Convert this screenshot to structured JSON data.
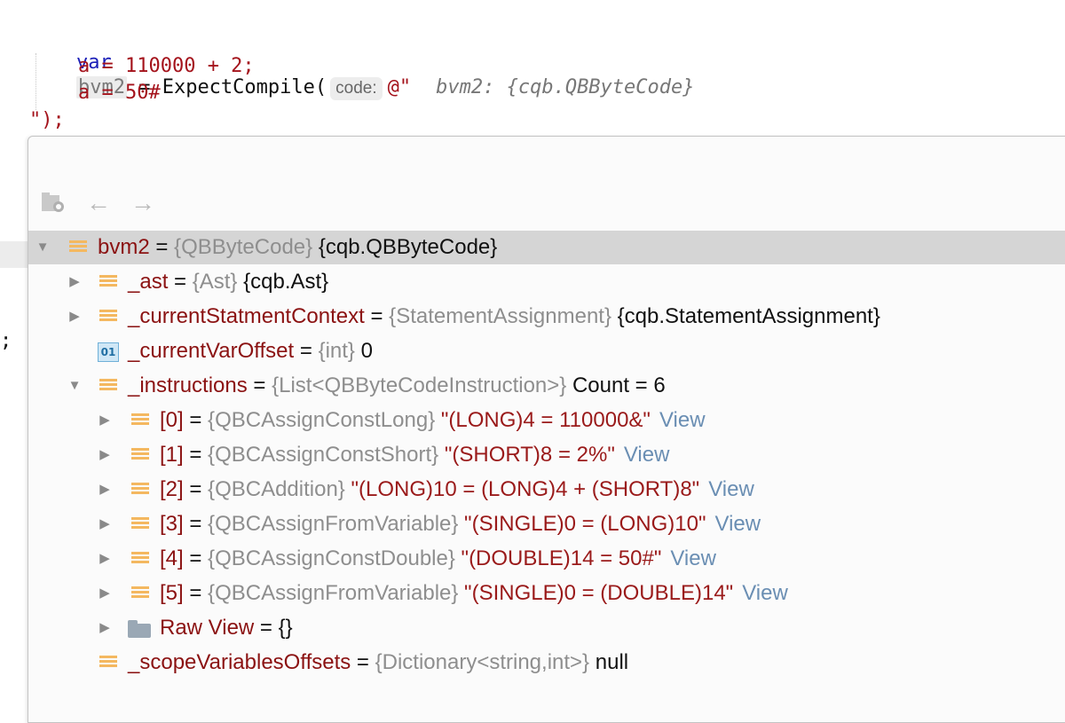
{
  "editor": {
    "line1": {
      "keyword": "var",
      "variable": "bvm2",
      "call": " = ExpectCompile(",
      "param_hint": "code:",
      "string_open": "@\"",
      "inline_value": "bvm2: {cqb.QBByteCode}"
    },
    "line2": "a = 110000 + 2;",
    "line3": "a = 50#",
    "line4": "\");",
    "left_fragment": ";"
  },
  "popup": {
    "toolbar": {
      "icons": [
        "watch-icon",
        "back-arrow-icon",
        "forward-arrow-icon"
      ]
    },
    "tree": [
      {
        "name": "bvm2",
        "eq": " = ",
        "type": "{QBByteCode}",
        "value": " {cqb.QBByteCode}"
      },
      {
        "name": "_ast",
        "eq": " = ",
        "type": "{Ast}",
        "value": " {cqb.Ast}"
      },
      {
        "name": "_currentStatmentContext",
        "eq": " = ",
        "type": "{StatementAssignment}",
        "value": " {cqb.StatementAssignment}"
      },
      {
        "name": "_currentVarOffset",
        "eq": " = ",
        "type": "{int}",
        "value": " 0",
        "icon_text": "01"
      },
      {
        "name": "_instructions",
        "eq": " = ",
        "type": "{List<QBByteCodeInstruction>}",
        "value": " Count = 6"
      },
      {
        "name": "[0]",
        "eq": " = ",
        "type": "{QBCAssignConstLong}",
        "value": " \"(LONG)4 = 110000&\"",
        "link": "View"
      },
      {
        "name": "[1]",
        "eq": " = ",
        "type": "{QBCAssignConstShort}",
        "value": " \"(SHORT)8 = 2%\"",
        "link": "View"
      },
      {
        "name": "[2]",
        "eq": " = ",
        "type": "{QBCAddition}",
        "value": " \"(LONG)10 = (LONG)4 + (SHORT)8\"",
        "link": "View"
      },
      {
        "name": "[3]",
        "eq": " = ",
        "type": "{QBCAssignFromVariable}",
        "value": " \"(SINGLE)0 = (LONG)10\"",
        "link": "View"
      },
      {
        "name": "[4]",
        "eq": " = ",
        "type": "{QBCAssignConstDouble}",
        "value": " \"(DOUBLE)14 = 50#\"",
        "link": "View"
      },
      {
        "name": "[5]",
        "eq": " = ",
        "type": "{QBCAssignFromVariable}",
        "value": " \"(SINGLE)0 = (DOUBLE)14\"",
        "link": "View"
      },
      {
        "name": "Raw View",
        "eq": " = ",
        "type": "",
        "value": "{}"
      },
      {
        "name": "_scopeVariablesOffsets",
        "eq": " = ",
        "type": "{Dictionary<string,int>}",
        "value": " null"
      }
    ]
  },
  "colors": {
    "keyword": "#1b1fb8",
    "string": "#a4121b",
    "field_name": "#8b1212",
    "type": "#8e8e8e",
    "link": "#6a8eb3",
    "field_icon": "#f4b860",
    "selection": "#d5d5d5"
  }
}
